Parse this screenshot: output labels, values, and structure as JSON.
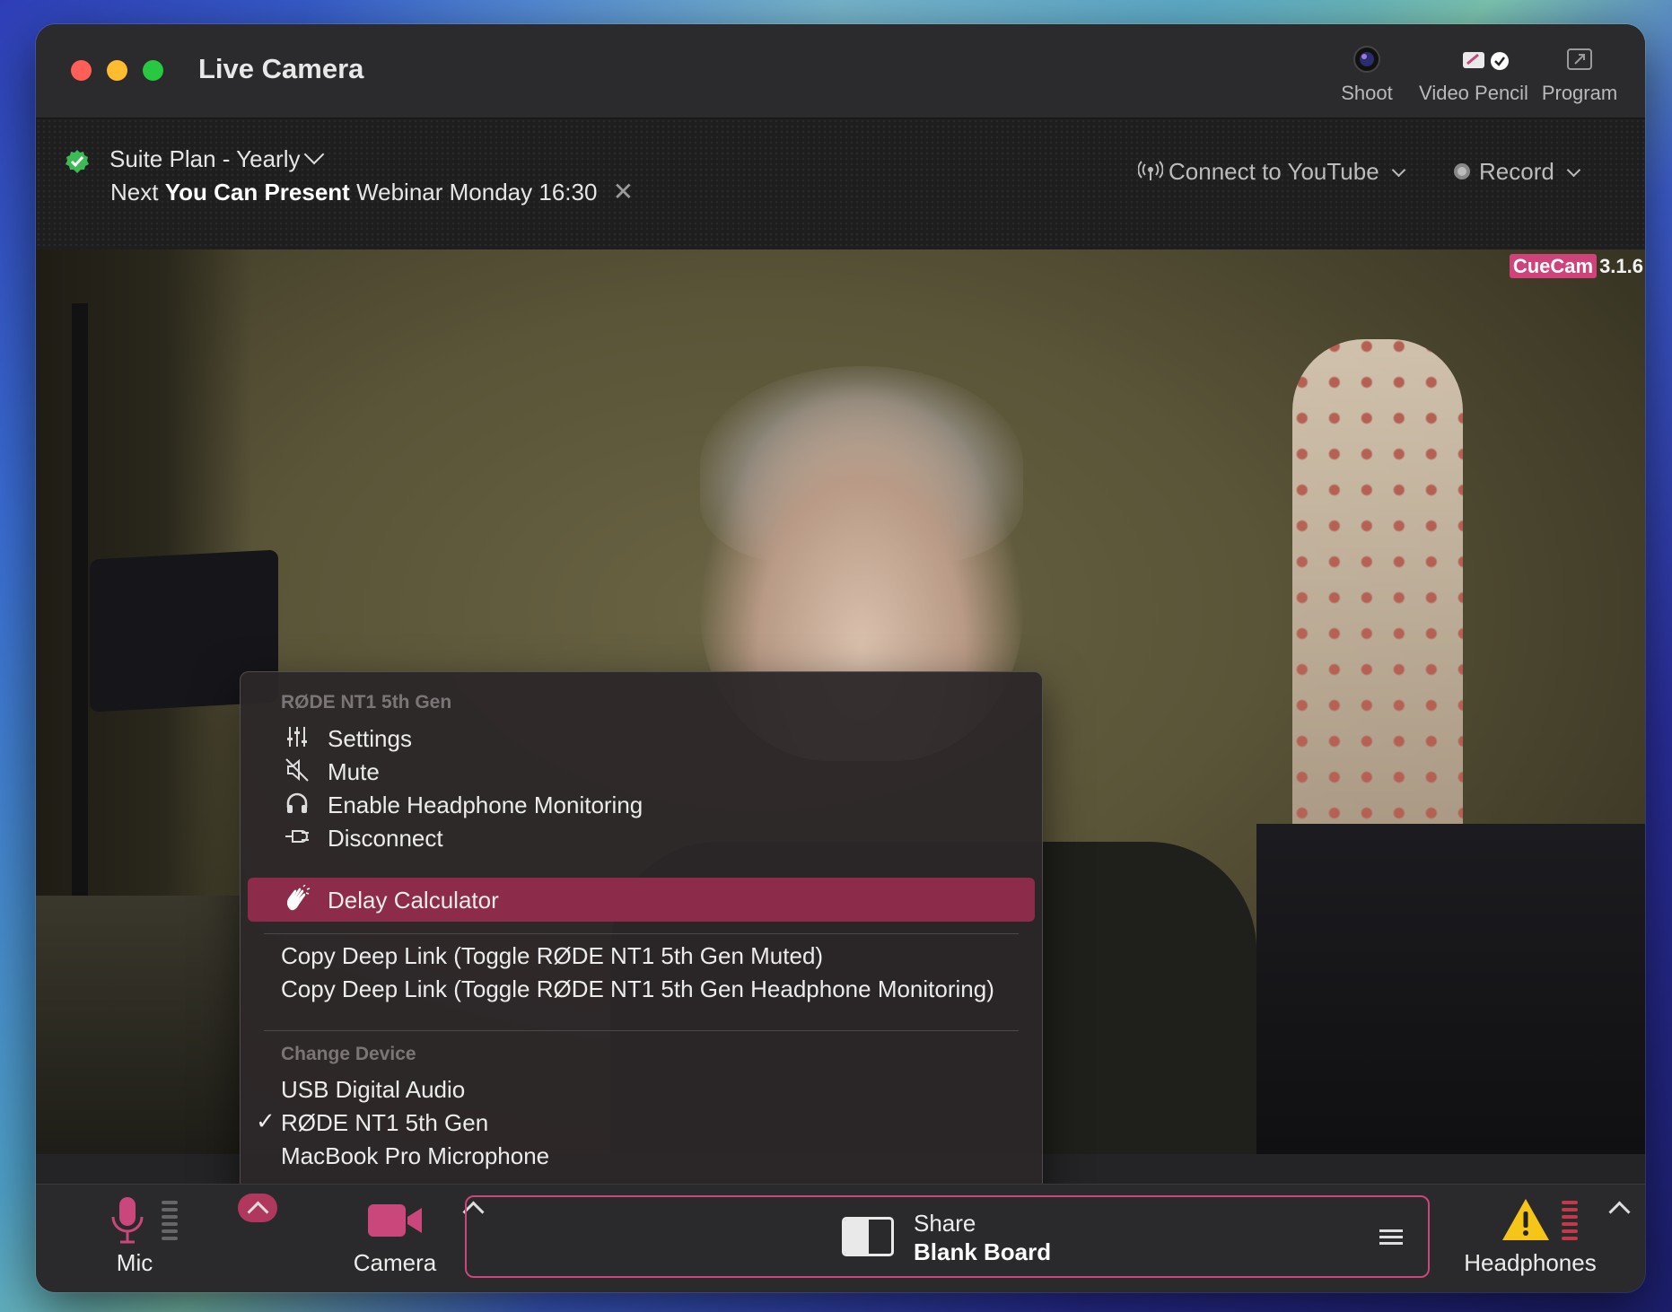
{
  "window": {
    "title": "Live Camera"
  },
  "toolbar": {
    "shoot_label": "Shoot",
    "video_pencil_label": "Video Pencil",
    "program_label": "Program"
  },
  "infobar": {
    "plan": "Suite Plan - Yearly",
    "webinar_prefix": "Next",
    "webinar_name": "You Can Present",
    "webinar_suffix": "Webinar  Monday 16:30",
    "connect_label": "Connect to YouTube",
    "record_label": "Record"
  },
  "video": {
    "badge_brand": "CueCam",
    "badge_version": "3.1.6"
  },
  "menu": {
    "device_header": "RØDE NT1 5th Gen",
    "items": [
      {
        "label": "Settings",
        "icon": "sliders-icon"
      },
      {
        "label": "Mute",
        "icon": "speaker-muted-icon"
      },
      {
        "label": "Enable Headphone Monitoring",
        "icon": "headphones-icon"
      },
      {
        "label": "Disconnect",
        "icon": "plug-icon"
      },
      {
        "label": "Delay Calculator",
        "icon": "clap-hands-icon",
        "selected": true
      }
    ],
    "deep_links": [
      "Copy Deep Link (Toggle RØDE NT1 5th Gen Muted)",
      "Copy Deep Link (Toggle RØDE NT1 5th Gen Headphone Monitoring)"
    ],
    "change_header": "Change Device",
    "devices": [
      {
        "label": "USB Digital Audio",
        "checked": false
      },
      {
        "label": "RØDE NT1 5th Gen",
        "checked": true
      },
      {
        "label": "MacBook Pro Microphone",
        "checked": false
      }
    ],
    "check_mark": "✓"
  },
  "bottom": {
    "mic_label": "Mic",
    "camera_label": "Camera",
    "share_top": "Share",
    "share_bottom": "Blank Board",
    "headphones_label": "Headphones"
  },
  "colors": {
    "accent": "#c9477a",
    "selection": "#8c2c4a",
    "badge": "#d0427a",
    "plan_check": "#3cba55",
    "warning": "#f5c518"
  }
}
